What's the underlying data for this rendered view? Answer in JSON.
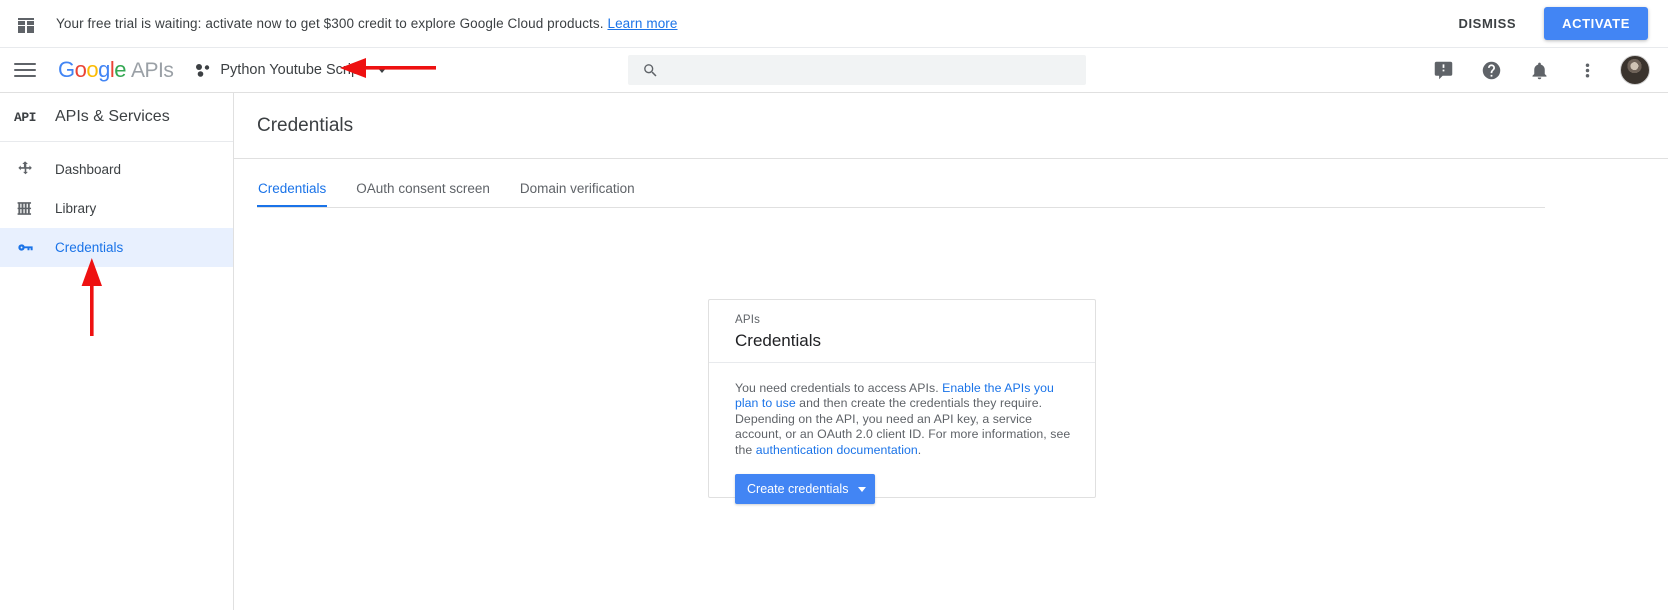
{
  "banner": {
    "icon": "gift-icon",
    "message": "Your free trial is waiting: activate now to get $300 credit to explore Google Cloud products.",
    "link_label": "Learn more",
    "dismiss_label": "DISMISS",
    "activate_label": "ACTIVATE",
    "activate_color": "#4285f4"
  },
  "appbar": {
    "menu_icon": "hamburger-icon",
    "logo_google": "Google",
    "logo_apis": "APIs",
    "project_icon": "project-dots-icon",
    "project_name": "Python Youtube Script",
    "search": {
      "icon": "search-icon",
      "value": "",
      "placeholder": ""
    },
    "icons": [
      {
        "name": "feedback-icon",
        "glyph": "!"
      },
      {
        "name": "help-icon",
        "glyph": "?"
      },
      {
        "name": "notifications-bell-icon",
        "glyph": "bell"
      },
      {
        "name": "more-options-icon",
        "glyph": "kebab"
      },
      {
        "name": "avatar",
        "glyph": "user-photo"
      }
    ]
  },
  "sidebar": {
    "product_mark": "API",
    "title": "APIs & Services",
    "items": [
      {
        "label": "Dashboard",
        "icon": "dashboard-icon",
        "active": false
      },
      {
        "label": "Library",
        "icon": "library-icon",
        "active": false
      },
      {
        "label": "Credentials",
        "icon": "key-icon",
        "active": true
      }
    ],
    "active_color": "#1a73e8",
    "active_bg": "#e8f0fe"
  },
  "main": {
    "page_title": "Credentials",
    "tabs": [
      {
        "label": "Credentials",
        "active": true
      },
      {
        "label": "OAuth consent screen",
        "active": false
      },
      {
        "label": "Domain verification",
        "active": false
      }
    ],
    "card": {
      "eyebrow": "APIs",
      "heading": "Credentials",
      "text_part1": "You need credentials to access APIs. ",
      "link1": "Enable the APIs you plan to use",
      "text_part2": " and then create the credentials they require. Depending on the API, you need an API key, a service account, or an OAuth 2.0 client ID. For more information, see the ",
      "link2": "authentication documentation",
      "text_part3": ".",
      "button_label": "Create credentials",
      "button_caret": "dropdown-caret-icon",
      "button_color": "#4285f4"
    }
  },
  "annotations": {
    "color": "#ee1111",
    "arrow_horizontal": "arrow-pointing-left-at-project-selector",
    "arrow_vertical": "arrow-pointing-up-at-credentials-nav"
  }
}
